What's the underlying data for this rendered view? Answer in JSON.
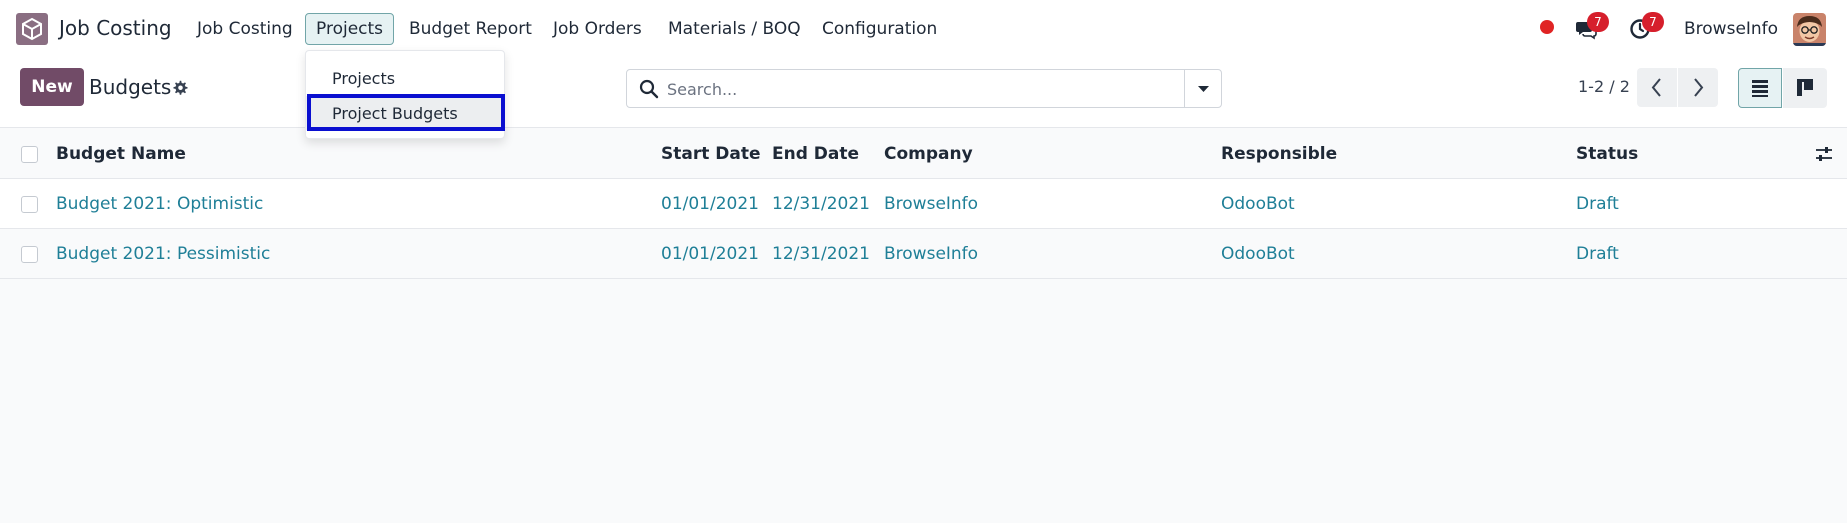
{
  "app": {
    "name": "Job Costing",
    "menu": [
      "Job Costing",
      "Projects",
      "Budget Report",
      "Job Orders",
      "Materials / BOQ",
      "Configuration"
    ]
  },
  "systray": {
    "messages_count": "7",
    "activities_count": "7",
    "user": "BrowseInfo"
  },
  "dropdown": {
    "items": [
      "Projects",
      "Project Budgets"
    ]
  },
  "control": {
    "new_label": "New",
    "title": "Budgets",
    "search_placeholder": "Search...",
    "pager": "1-2 / 2"
  },
  "table": {
    "columns": [
      "Budget Name",
      "Start Date",
      "End Date",
      "Company",
      "Responsible",
      "Status"
    ],
    "rows": [
      {
        "name": "Budget 2021: Optimistic",
        "start": "01/01/2021",
        "end": "12/31/2021",
        "company": "BrowseInfo",
        "responsible": "OdooBot",
        "status": "Draft"
      },
      {
        "name": "Budget 2021: Pessimistic",
        "start": "01/01/2021",
        "end": "12/31/2021",
        "company": "BrowseInfo",
        "responsible": "OdooBot",
        "status": "Draft"
      }
    ]
  },
  "colors": {
    "brand": "#714b67",
    "link": "#1f7f97",
    "badge": "#d61f2c",
    "highlight_outline": "#0a0fd0"
  }
}
